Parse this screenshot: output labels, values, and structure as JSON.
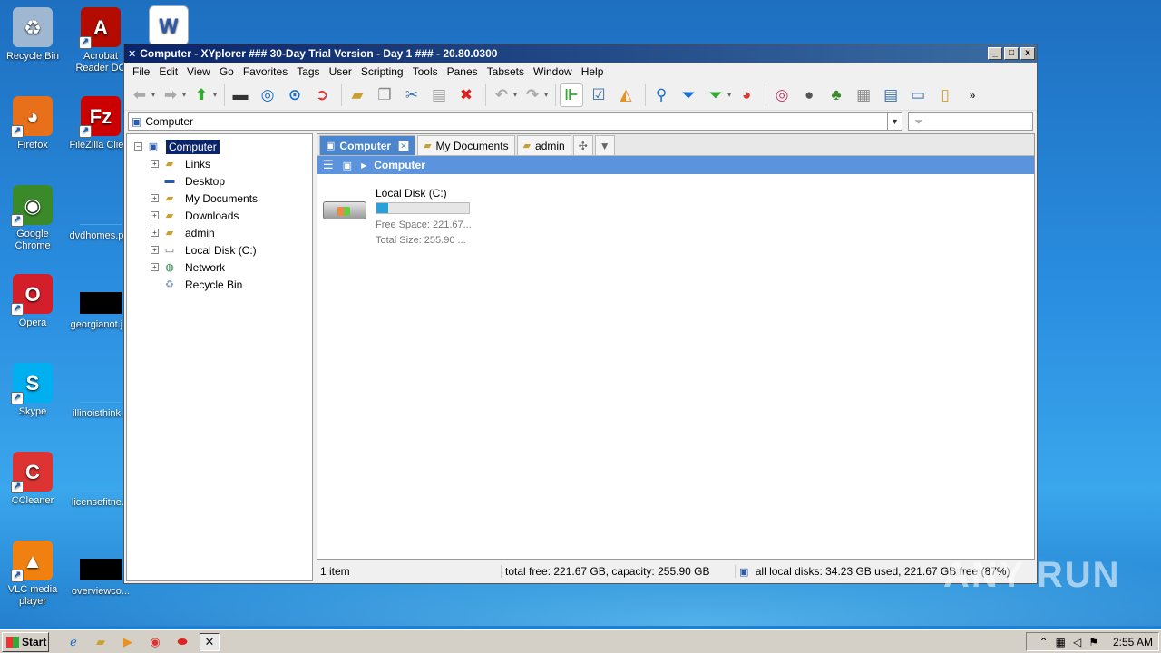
{
  "desktop": {
    "col1": [
      {
        "label": "Recycle Bin",
        "icon": "recycle-bin-icon"
      },
      {
        "label": "Firefox",
        "icon": "firefox-icon"
      },
      {
        "label": "Google Chrome",
        "icon": "chrome-icon"
      },
      {
        "label": "Opera",
        "icon": "opera-icon"
      },
      {
        "label": "Skype",
        "icon": "skype-icon"
      },
      {
        "label": "CCleaner",
        "icon": "ccleaner-icon"
      },
      {
        "label": "VLC media player",
        "icon": "vlc-icon"
      }
    ],
    "col2": [
      {
        "label": "Acrobat Reader DC",
        "icon": "acrobat-icon"
      },
      {
        "label": "FileZilla Client",
        "icon": "filezilla-icon"
      },
      {
        "label": "dvdhomes.p...",
        "icon": "file-icon"
      },
      {
        "label": "georgianot.j...",
        "icon": "file-icon"
      },
      {
        "label": "illinoisthink...",
        "icon": "file-icon"
      },
      {
        "label": "licensefitne...",
        "icon": "file-icon"
      },
      {
        "label": "overviewco...",
        "icon": "file-icon"
      }
    ],
    "col3": [
      {
        "label": "",
        "icon": "word-document-icon"
      }
    ]
  },
  "window": {
    "title": "Computer - XYplorer ### 30-Day Trial Version - Day 1 ### - 20.80.0300",
    "app_icon": "xyplorer-icon",
    "minimize": "_",
    "maximize": "□",
    "close": "x"
  },
  "menu": [
    "File",
    "Edit",
    "View",
    "Go",
    "Favorites",
    "Tags",
    "User",
    "Scripting",
    "Tools",
    "Panes",
    "Tabsets",
    "Window",
    "Help"
  ],
  "address": {
    "value": "Computer",
    "filter_placeholder": ""
  },
  "tree": [
    {
      "label": "Computer",
      "icon": "computer-icon",
      "expander": "−",
      "indent": 0,
      "selected": true
    },
    {
      "label": "Links",
      "icon": "links-folder-icon",
      "expander": "+",
      "indent": 1
    },
    {
      "label": "Desktop",
      "icon": "desktop-icon",
      "expander": "",
      "indent": 1
    },
    {
      "label": "My Documents",
      "icon": "documents-folder-icon",
      "expander": "+",
      "indent": 1
    },
    {
      "label": "Downloads",
      "icon": "downloads-folder-icon",
      "expander": "+",
      "indent": 1
    },
    {
      "label": "admin",
      "icon": "user-folder-icon",
      "expander": "+",
      "indent": 1
    },
    {
      "label": "Local Disk (C:)",
      "icon": "drive-icon",
      "expander": "+",
      "indent": 1
    },
    {
      "label": "Network",
      "icon": "network-icon",
      "expander": "+",
      "indent": 1
    },
    {
      "label": "Recycle Bin",
      "icon": "recycle-bin-icon",
      "expander": "",
      "indent": 1
    }
  ],
  "tabs": [
    {
      "label": "Computer",
      "icon": "computer-icon",
      "active": true
    },
    {
      "label": "My Documents",
      "icon": "documents-folder-icon",
      "active": false
    },
    {
      "label": "admin",
      "icon": "user-folder-icon",
      "active": false
    }
  ],
  "breadcrumb": {
    "current": "Computer"
  },
  "drive": {
    "name": "Local Disk (C:)",
    "free": "Free Space: 221.67...",
    "total": "Total Size: 255.90 ...",
    "used_fraction": 0.13
  },
  "status": {
    "items": "1 item",
    "free": "total free: 221.67 GB, capacity: 255.90 GB",
    "disks": "all local disks: 34.23 GB used, 221.67 GB free (87%)"
  },
  "taskbar": {
    "start": "Start",
    "clock": "2:55 AM"
  },
  "watermark": "ANY RUN",
  "colors": {
    "title_bar": "#0a246a",
    "tab_active": "#4a86d0",
    "breadcrumb_bar": "#5b94dc",
    "usage_bar": "#27a0dc"
  }
}
